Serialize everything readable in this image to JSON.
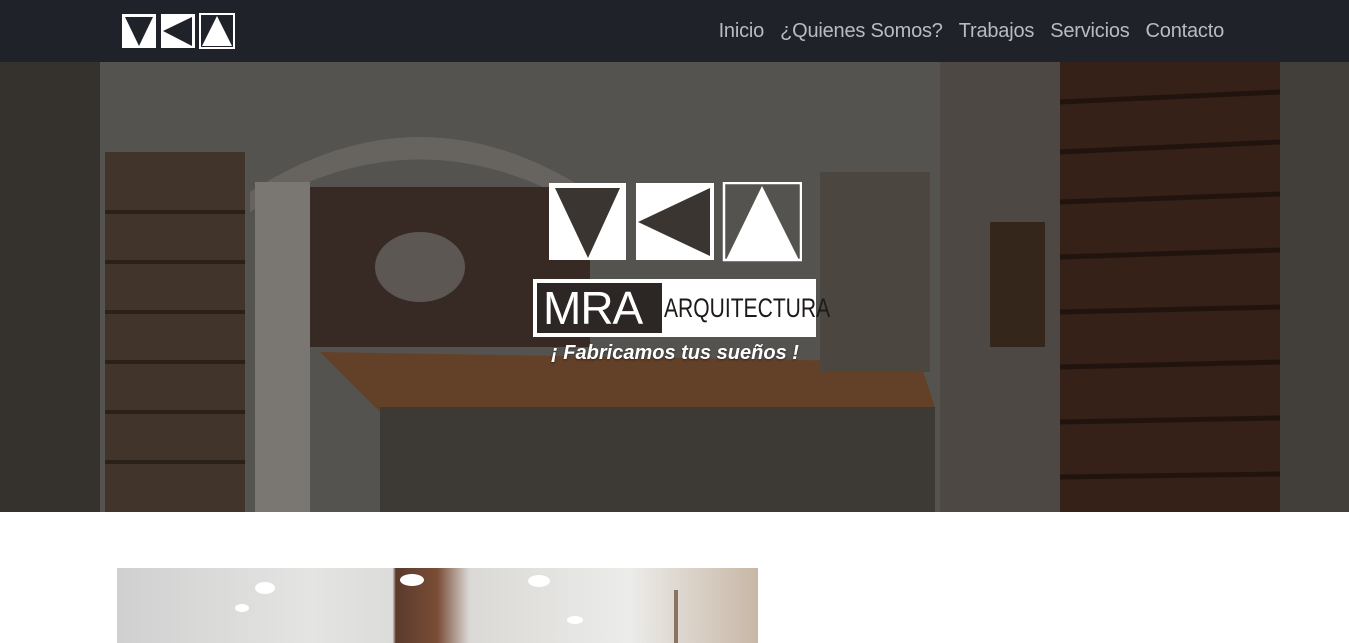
{
  "navbar": {
    "logo_icon": "vka-triangles-logo-icon",
    "links": [
      "Inicio",
      "¿Quienes Somos?",
      "Trabajos",
      "Servicios",
      "Contacto"
    ]
  },
  "hero": {
    "background": "wine-cellar-interior-photo",
    "brand": {
      "mark_icon": "vka-triangles-logo-icon",
      "name_left": "MRA",
      "name_right": "ARQUITECTURA",
      "tagline": "¡ Fabricamos tus sueños !"
    }
  },
  "content": {
    "image": "interior-photo"
  },
  "colors": {
    "navbar_bg": "#1f2329",
    "nav_link": "#b8bcc2",
    "brand_white": "#ffffff",
    "brand_dark": "#2c2724"
  }
}
